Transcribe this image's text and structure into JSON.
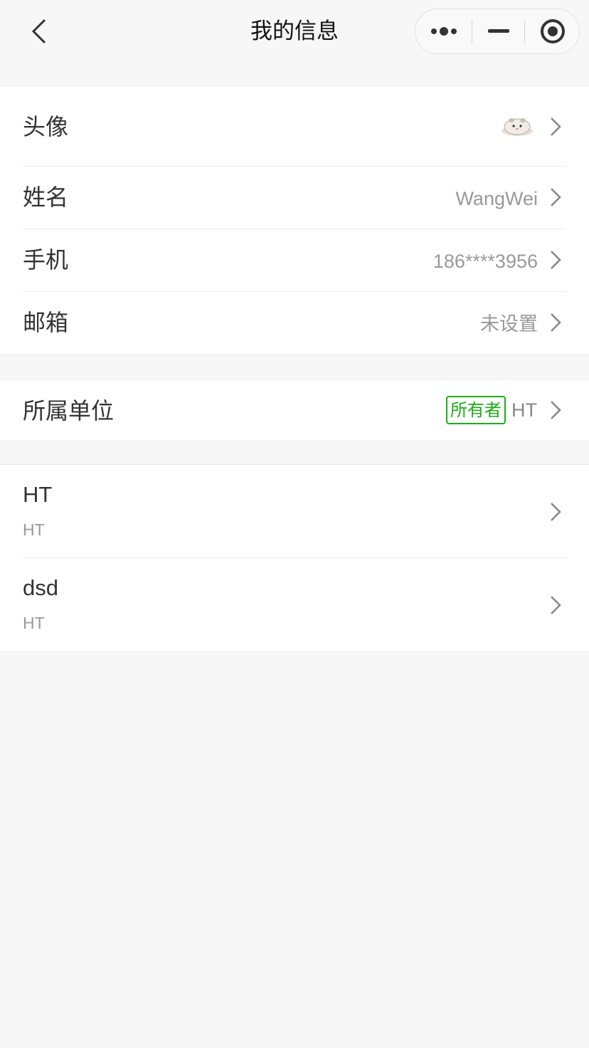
{
  "nav": {
    "title": "我的信息"
  },
  "profile": {
    "avatar_label": "头像",
    "name_label": "姓名",
    "name_value": "WangWei",
    "phone_label": "手机",
    "phone_value": "186****3956",
    "email_label": "邮箱",
    "email_value": "未设置"
  },
  "organization": {
    "label": "所属单位",
    "badge": "所有者",
    "value": "HT"
  },
  "units": [
    {
      "title": "HT",
      "subtitle": "HT"
    },
    {
      "title": "dsd",
      "subtitle": "HT"
    }
  ],
  "colors": {
    "accent_green": "#1aad19",
    "background": "#f7f7f7"
  }
}
